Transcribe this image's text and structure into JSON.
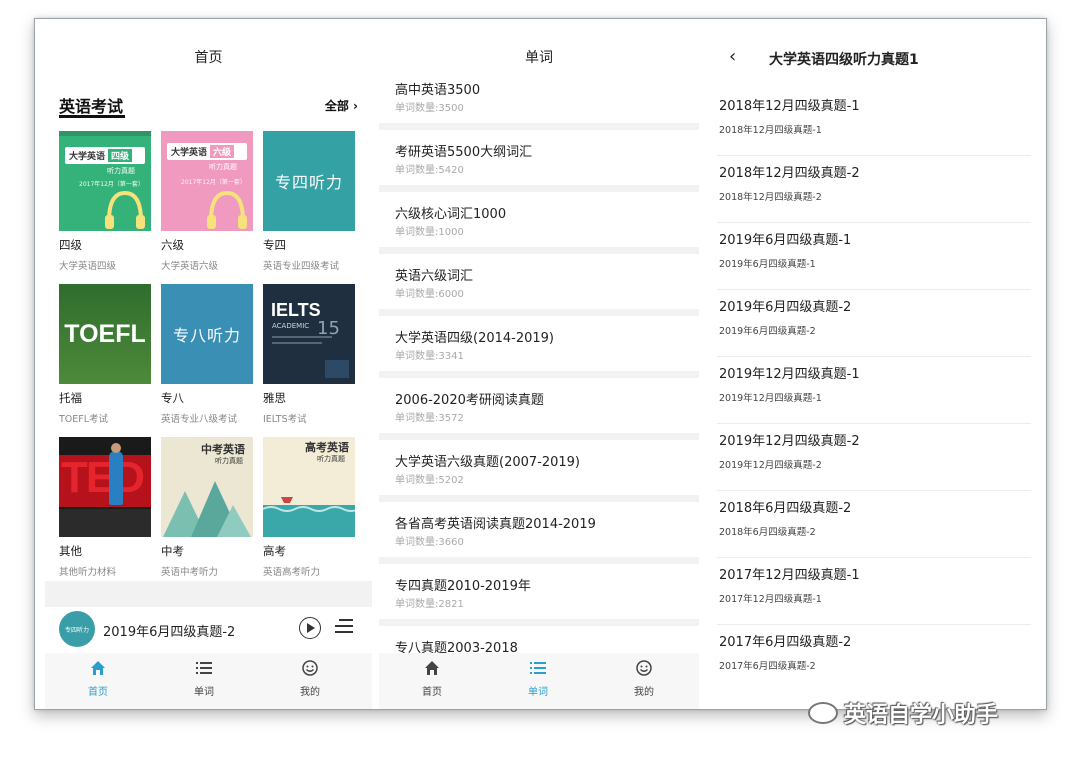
{
  "home": {
    "title": "首页",
    "section_title": "英语考试",
    "section_all": "全部 ›",
    "cards": [
      {
        "name": "四级",
        "sub": "大学英语四级",
        "cover_line1": "大学英语",
        "cover_tag": "四级",
        "cover_line2": "听力真题",
        "cover_line3": "2017年12月（第一套）",
        "cover_color": "#35b27a"
      },
      {
        "name": "六级",
        "sub": "大学英语六级",
        "cover_line1": "大学英语",
        "cover_tag": "六级",
        "cover_line2": "听力真题",
        "cover_line3": "2017年12月（第一套）",
        "cover_color": "#f19ac0"
      },
      {
        "name": "专四",
        "sub": "英语专业四级考试",
        "cover_text": "专四听力",
        "cover_color": "#34a2a5"
      },
      {
        "name": "托福",
        "sub": "TOEFL考试",
        "cover_text": "TOEFL",
        "cover_color": "#2f6d2e"
      },
      {
        "name": "专八",
        "sub": "英语专业八级考试",
        "cover_text": "专八听力",
        "cover_color": "#3a8fb5"
      },
      {
        "name": "雅思",
        "sub": "IELTS考试",
        "cover_text": "IELTS",
        "cover_sub": "ACADEMIC",
        "cover_num": "15",
        "cover_color": "#1f2f3f"
      },
      {
        "name": "其他",
        "sub": "其他听力材料",
        "cover_text": "TED",
        "cover_color": "#b5121b"
      },
      {
        "name": "中考",
        "sub": "英语中考听力",
        "cover_text": "中考英语",
        "cover_sub": "听力真题",
        "cover_color": "#ece7d3"
      },
      {
        "name": "高考",
        "sub": "英语高考听力",
        "cover_text": "高考英语",
        "cover_sub": "听力真题",
        "cover_color": "#f3ecd6"
      }
    ],
    "player": {
      "avatar_text": "专四听力",
      "title": "2019年6月四级真题-2"
    },
    "tabs": [
      {
        "label": "首页",
        "icon": "home-icon"
      },
      {
        "label": "单词",
        "icon": "list-icon"
      },
      {
        "label": "我的",
        "icon": "smile-icon"
      }
    ]
  },
  "words": {
    "title": "单词",
    "items": [
      {
        "name": "高中英语3500",
        "count": "单词数量:3500"
      },
      {
        "name": "考研英语5500大纲词汇",
        "count": "单词数量:5420"
      },
      {
        "name": "六级核心词汇1000",
        "count": "单词数量:1000"
      },
      {
        "name": "英语六级词汇",
        "count": "单词数量:6000"
      },
      {
        "name": "大学英语四级(2014-2019)",
        "count": "单词数量:3341"
      },
      {
        "name": "2006-2020考研阅读真题",
        "count": "单词数量:3572"
      },
      {
        "name": "大学英语六级真题(2007-2019)",
        "count": "单词数量:5202"
      },
      {
        "name": "各省高考英语阅读真题2014-2019",
        "count": "单词数量:3660"
      },
      {
        "name": "专四真题2010-2019年",
        "count": "单词数量:2821"
      },
      {
        "name": "专八真题2003-2018",
        "count": ""
      }
    ],
    "tabs": [
      {
        "label": "首页",
        "icon": "home-icon"
      },
      {
        "label": "单词",
        "icon": "list-icon"
      },
      {
        "label": "我的",
        "icon": "smile-icon"
      }
    ]
  },
  "detail": {
    "back": "‹",
    "title": "大学英语四级听力真题1",
    "items": [
      {
        "name": "2018年12月四级真题-1",
        "sub": "2018年12月四级真题-1"
      },
      {
        "name": "2018年12月四级真题-2",
        "sub": "2018年12月四级真题-2"
      },
      {
        "name": "2019年6月四级真题-1",
        "sub": "2019年6月四级真题-1"
      },
      {
        "name": "2019年6月四级真题-2",
        "sub": "2019年6月四级真题-2"
      },
      {
        "name": "2019年12月四级真题-1",
        "sub": "2019年12月四级真题-1"
      },
      {
        "name": "2019年12月四级真题-2",
        "sub": "2019年12月四级真题-2"
      },
      {
        "name": "2018年6月四级真题-2",
        "sub": "2018年6月四级真题-2"
      },
      {
        "name": "2017年12月四级真题-1",
        "sub": "2017年12月四级真题-1"
      },
      {
        "name": "2017年6月四级真题-2",
        "sub": "2017年6月四级真题-2"
      }
    ]
  },
  "watermark": "英语自学小助手",
  "colors": {
    "accent": "#2a9fcf",
    "separator": "#f2f2f2"
  }
}
